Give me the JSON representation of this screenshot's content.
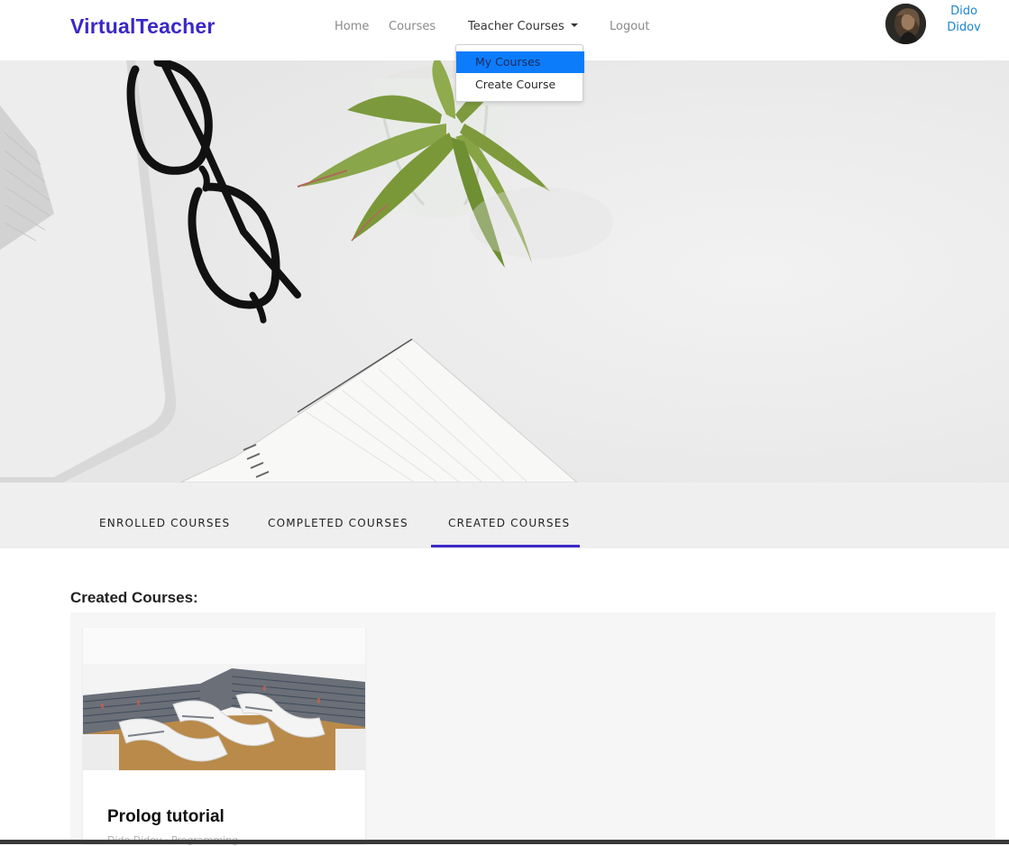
{
  "navbar": {
    "brand": "VirtualTeacher",
    "links": {
      "home": "Home",
      "courses": "Courses",
      "teacher_courses": "Teacher Courses",
      "logout": "Logout"
    },
    "user": {
      "first_name": "Dido",
      "last_name": "Didov"
    }
  },
  "dropdown": {
    "items": [
      {
        "label": "My Courses",
        "active": true
      },
      {
        "label": "Create Course",
        "active": false
      }
    ]
  },
  "tabs": [
    {
      "label": "ENROLLED COURSES",
      "active": false
    },
    {
      "label": "COMPLETED COURSES",
      "active": false
    },
    {
      "label": "CREATED COURSES",
      "active": true
    }
  ],
  "main": {
    "section_title": "Created Courses:",
    "courses": [
      {
        "title": "Prolog tutorial",
        "subtitle": "Dido Didov · Programming"
      }
    ]
  },
  "colors": {
    "brand": "#3a28c7",
    "user_link": "#1a86d0",
    "dropdown_active": "#0d7cfb",
    "tab_underline": "#3a28c7"
  }
}
